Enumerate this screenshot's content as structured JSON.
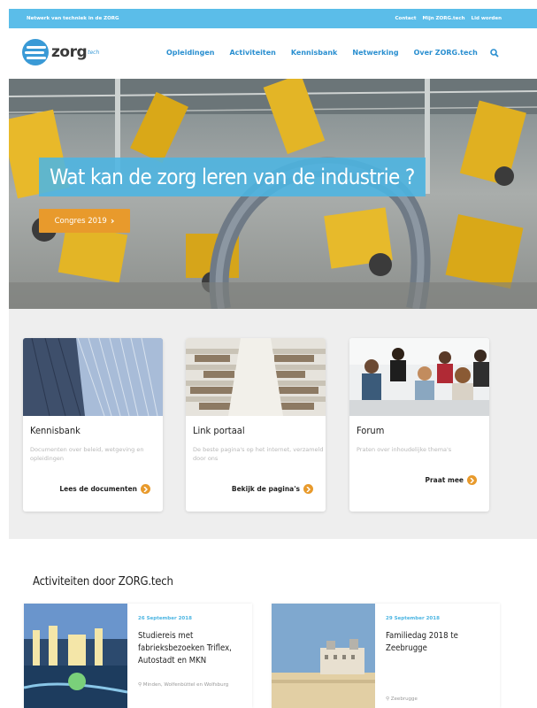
{
  "topbar": {
    "tagline": "Netwerk van techniek in de ZORG",
    "links": [
      "Contact",
      "Mijn ZORG.tech",
      "Lid worden"
    ]
  },
  "header": {
    "logo_text": "zorg",
    "logo_sup": "tech",
    "nav": [
      "Opleidingen",
      "Activiteiten",
      "Kennisbank",
      "Netwerking",
      "Over ZORG.tech"
    ]
  },
  "hero": {
    "title": "Wat kan de zorg leren van de industrie ?",
    "cta_label": "Congres 2019",
    "cta_glyph": "›"
  },
  "cards": [
    {
      "title": "Kennisbank",
      "description": "Documenten over beleid, wetgeving en opleidingen",
      "link": "Lees de documenten"
    },
    {
      "title": "Link portaal",
      "description": "De beste pagina's op het internet, verzameld door ons",
      "link": "Bekijk de pagina's"
    },
    {
      "title": "Forum",
      "description": "Praten over inhoudelijke thema's",
      "link": "Praat mee"
    }
  ],
  "activities": {
    "heading": "Activiteiten door ZORG.tech",
    "items": [
      {
        "date": "26 September 2018",
        "title": "Studiereis met fabrieksbezoeken Triflex, Autostadt en MKN",
        "location": "Minden, Wolfenbüttel en Wolfsburg"
      },
      {
        "date": "29 September 2018",
        "title": "Familiedag 2018 te Zeebrugge",
        "location": "Zeebrugge"
      }
    ]
  },
  "colors": {
    "accent_blue": "#4cb5e2",
    "nav_blue": "#2a8fd0",
    "orange": "#e89a2c"
  }
}
